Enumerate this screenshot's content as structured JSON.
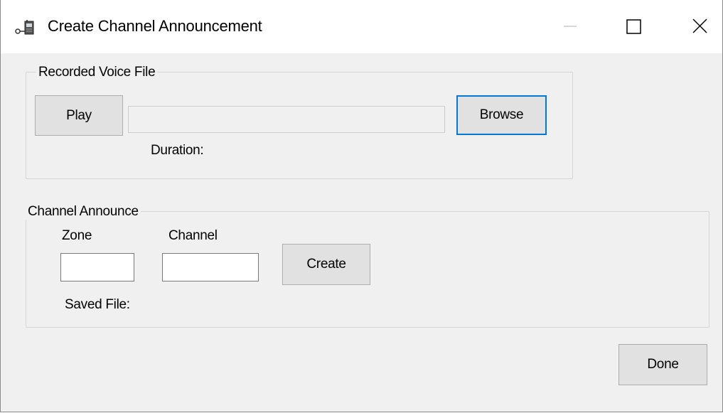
{
  "window": {
    "title": "Create Channel Announcement",
    "controls": {
      "minimize_icon": "minimize-icon",
      "maximize_icon": "maximize-icon",
      "close_icon": "close-icon"
    }
  },
  "recorded_voice": {
    "legend": "Recorded Voice File",
    "play_label": "Play",
    "file_path": "",
    "browse_label": "Browse",
    "duration_label": "Duration:"
  },
  "channel_announce": {
    "legend": "Channel Announce",
    "zone_label": "Zone",
    "zone_value": "",
    "channel_label": "Channel",
    "channel_value": "",
    "create_label": "Create",
    "saved_file_label": "Saved File:"
  },
  "footer": {
    "done_label": "Done"
  },
  "colors": {
    "focus_border": "#0078d7",
    "button_face": "#e1e1e1",
    "window_bg": "#f0f0f0"
  }
}
